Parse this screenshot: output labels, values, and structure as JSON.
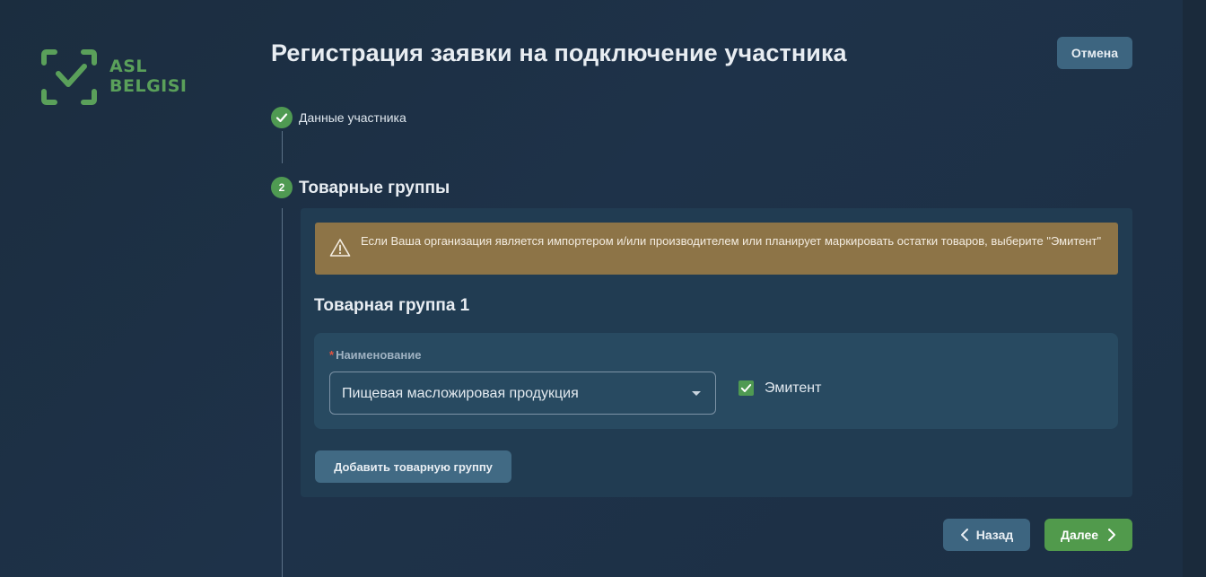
{
  "brand": {
    "logo_line1": "ASL",
    "logo_line2": "BELGISI",
    "color": "#5aa05a"
  },
  "header": {
    "title": "Регистрация заявки на подключение участника",
    "cancel_label": "Отмена"
  },
  "steps": [
    {
      "label": "Данные участника",
      "status": "completed"
    },
    {
      "number": "2",
      "label": "Товарные группы",
      "status": "active"
    }
  ],
  "alert": {
    "icon": "warning-triangle-icon",
    "text": "Если Ваша организация является импортером и/или производителем или планирует маркировать остатки товаров, выберите \"Эмитент\""
  },
  "product_groups": [
    {
      "title": "Товарная группа 1",
      "name_label": "Наименование",
      "required_mark": "*",
      "name_value": "Пищевая масложировая продукция",
      "emitent_label": "Эмитент",
      "emitent_checked": true
    }
  ],
  "add_group_label": "Добавить товарную группу",
  "nav": {
    "back_label": "Назад",
    "next_label": "Далее"
  },
  "colors": {
    "accent_green": "#519a4c",
    "alert_bg": "#8d7447",
    "secondary_button": "#3d6580"
  }
}
